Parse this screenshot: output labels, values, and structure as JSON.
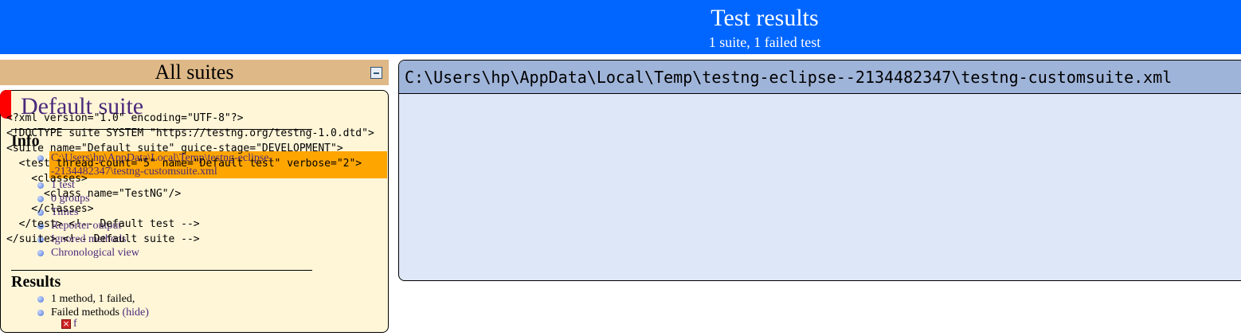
{
  "banner": {
    "title": "Test results",
    "subtitle": "1 suite, 1 failed test"
  },
  "navigator": {
    "header": "All suites",
    "suite": {
      "name": "Default suite",
      "info_heading": "Info",
      "info_items": [
        "C:\\Users\\hp\\AppData\\Local\\Temp\\testng-eclipse-",
        "-2134482347\\testng-customsuite.xml",
        "1 test",
        "0 groups",
        "Times",
        "Reporter output",
        "Ignored methods",
        "Chronological view"
      ],
      "results_heading": "Results",
      "results_items": [
        "1 method, 1 failed,",
        "Failed methods",
        "(hide)"
      ],
      "failed_method": "f",
      "fail_icon": "failed-x-icon"
    }
  },
  "xml_view": {
    "path": "C:\\Users\\hp\\AppData\\Local\\Temp\\testng-eclipse--2134482347\\testng-customsuite.xml",
    "content": "<?xml version=\"1.0\" encoding=\"UTF-8\"?>\n<!DOCTYPE suite SYSTEM \"https://testng.org/testng-1.0.dtd\">\n<suite name=\"Default suite\" guice-stage=\"DEVELOPMENT\">\n  <test thread-count=\"5\" name=\"Default test\" verbose=\"2\">\n    <classes>\n      <class name=\"TestNG\"/>\n    </classes>\n  </test> <!-- Default test -->\n</suite> <!-- Default suite -->"
  },
  "colors": {
    "banner": "#0066ff",
    "navigator_header": "#deb887",
    "suite_panel": "#fff6d8",
    "selected_item": "#ffa500",
    "xml_panel": "#dde7f8",
    "xml_header": "#9fb4d9",
    "link": "#4b2a7b",
    "fail_marker": "#ff0000"
  }
}
